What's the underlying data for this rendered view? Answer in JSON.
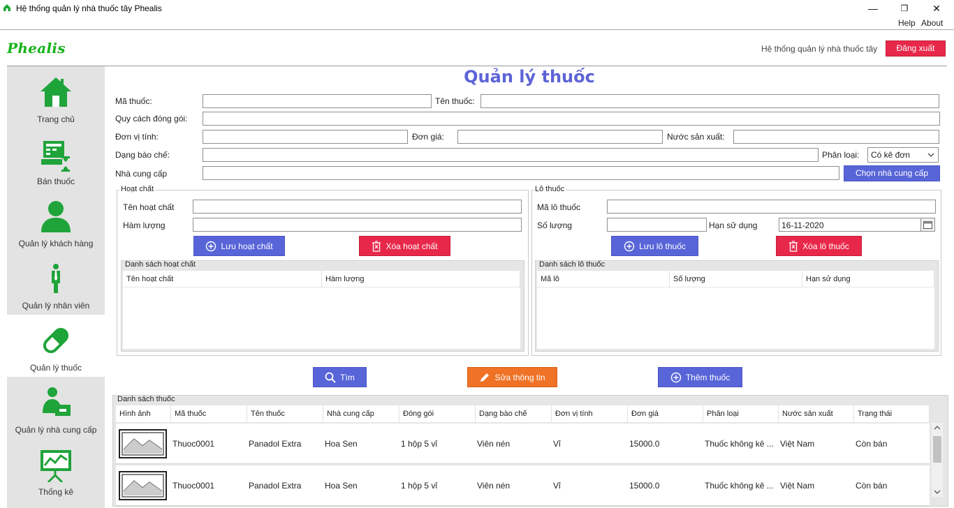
{
  "window": {
    "title": "Hệ thống quản lý nhà thuốc tây Phealis",
    "menu": {
      "help": "Help",
      "about": "About"
    }
  },
  "header": {
    "logo": "Phealis",
    "system_label": "Hệ thống quản lý nhà thuốc tây",
    "logout": "Đăng xuất"
  },
  "sidebar": {
    "items": [
      {
        "label": "Trang chủ",
        "icon": "home-icon"
      },
      {
        "label": "Bán thuốc",
        "icon": "sell-icon"
      },
      {
        "label": "Quản lý khách hàng",
        "icon": "customer-icon"
      },
      {
        "label": "Quản lý nhân viên",
        "icon": "employee-icon"
      },
      {
        "label": "Quản lý thuốc",
        "icon": "pill-icon",
        "active": true
      },
      {
        "label": "Quản lý nhà cung cấp",
        "icon": "supplier-icon"
      },
      {
        "label": "Thống kê",
        "icon": "stats-icon"
      }
    ]
  },
  "page": {
    "title": "Quản lý thuốc"
  },
  "form": {
    "ma_thuoc": "Mã thuốc:",
    "ten_thuoc": "Tên thuốc:",
    "quy_cach": "Quy cách đóng gói:",
    "don_vi": "Đơn vị tính:",
    "don_gia": "Đơn giá:",
    "nuoc_sx": "Nước sản xuất:",
    "dang_bao_che": "Dạng bào chế:",
    "phan_loai": "Phân loại:",
    "phan_loai_value": "Có kê đơn",
    "nha_cung_cap": "Nhà cung cấp",
    "chon_ncc": "Chọn nhà cung cấp"
  },
  "hoat_chat": {
    "title": "Hoạt chất",
    "ten_label": "Tên hoạt chất",
    "ham_luong_label": "Hàm lượng",
    "save": "Lưu hoạt chất",
    "delete": "Xóa hoạt chất",
    "list_title": "Danh sách hoạt chất",
    "columns": [
      "Tên hoạt chất",
      "Hàm lượng"
    ]
  },
  "lo_thuoc": {
    "title": "Lô thuốc",
    "ma_label": "Mã lô thuốc",
    "so_luong_label": "Số lượng",
    "han_label": "Hạn sử dụng",
    "han_value": "16-11-2020",
    "save": "Lưu lô thuốc",
    "delete": "Xóa lô thuốc",
    "list_title": "Danh sách lô thuốc",
    "columns": [
      "Mã lô",
      "Số lượng",
      "Hạn sử dụng"
    ]
  },
  "actions": {
    "search": "Tìm",
    "edit": "Sửa thông tin",
    "add": "Thêm thuốc"
  },
  "drug_list": {
    "title": "Danh sách thuốc",
    "columns": [
      "Hình ảnh",
      "Mã thuốc",
      "Tên thuốc",
      "Nhà cung cấp",
      "Đóng gói",
      "Dạng bào chế",
      "Đơn vị tính",
      "Đơn giá",
      "Phân loại",
      "Nước sản xuất",
      "Trạng thái"
    ],
    "rows": [
      {
        "ma": "Thuoc0001",
        "ten": "Panadol Extra",
        "ncc": "Hoa Sen",
        "dong_goi": "1 hộp 5 vỉ",
        "dang": "Viên nén",
        "dvt": "Vỉ",
        "gia": "15000.0",
        "loai": "Thuốc không kê ...",
        "nuoc": "Việt Nam",
        "trang_thai": "Còn bán"
      },
      {
        "ma": "Thuoc0001",
        "ten": "Panadol Extra",
        "ncc": "Hoa Sen",
        "dong_goi": "1 hộp 5 vỉ",
        "dang": "Viên nén",
        "dvt": "Vỉ",
        "gia": "15000.0",
        "loai": "Thuốc không kê ...",
        "nuoc": "Việt Nam",
        "trang_thai": "Còn bán"
      }
    ]
  },
  "colors": {
    "accent": "#5865d8",
    "danger": "#e8284a",
    "warning": "#ef7226",
    "brand": "#17b31c"
  }
}
